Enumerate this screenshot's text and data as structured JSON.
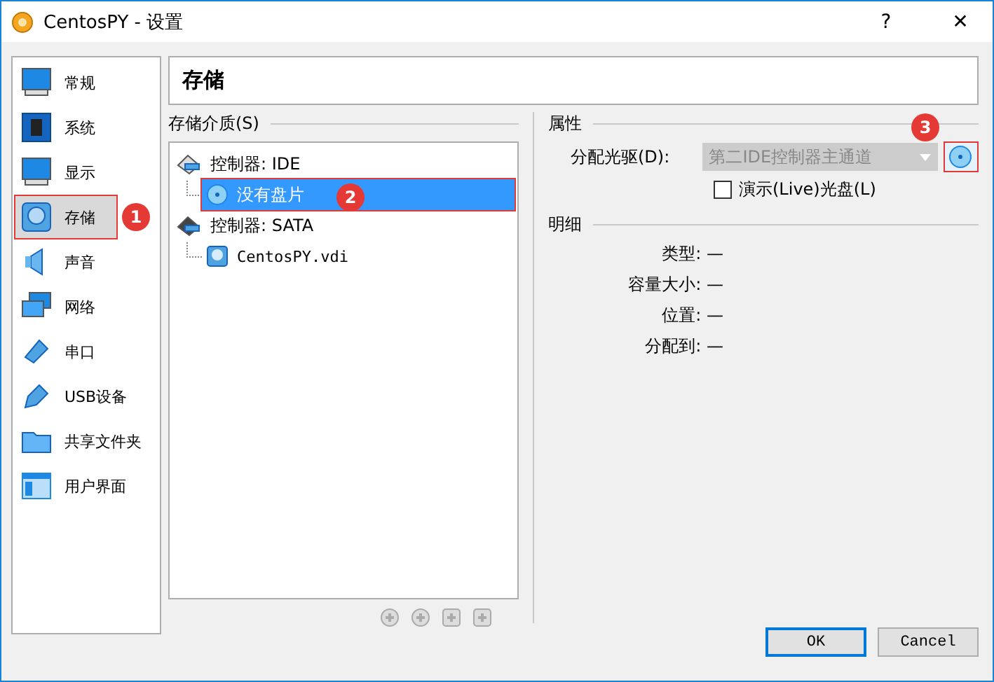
{
  "window": {
    "title": "CentosPY - 设置",
    "help": "?",
    "close": "✕"
  },
  "sidebar": {
    "items": [
      {
        "label": "常规",
        "selected": false
      },
      {
        "label": "系统",
        "selected": false
      },
      {
        "label": "显示",
        "selected": false
      },
      {
        "label": "存储",
        "selected": true
      },
      {
        "label": "声音",
        "selected": false
      },
      {
        "label": "网络",
        "selected": false
      },
      {
        "label": "串口",
        "selected": false
      },
      {
        "label": "USB设备",
        "selected": false
      },
      {
        "label": "共享文件夹",
        "selected": false
      },
      {
        "label": "用户界面",
        "selected": false
      }
    ]
  },
  "page_title": "存储",
  "storage": {
    "label": "存储介质(S)",
    "tree": [
      {
        "label": "控制器: IDE",
        "children": [
          {
            "label": "没有盘片",
            "kind": "optical",
            "selected": true
          }
        ]
      },
      {
        "label": "控制器: SATA",
        "children": [
          {
            "label": "CentosPY.vdi",
            "kind": "disk",
            "selected": false
          }
        ]
      }
    ]
  },
  "attributes": {
    "label": "属性",
    "drive_label": "分配光驱(D):",
    "drive_value": "第二IDE控制器主通道",
    "drive_disabled": true,
    "live_cd": {
      "label": "演示(Live)光盘(L)",
      "checked": false
    }
  },
  "details": {
    "label": "明细",
    "rows": [
      "类型: —",
      "容量大小: —",
      "位置: —",
      "分配到: —"
    ]
  },
  "annotations": [
    "1",
    "2",
    "3"
  ],
  "buttons": [
    "OK",
    "Cancel"
  ]
}
